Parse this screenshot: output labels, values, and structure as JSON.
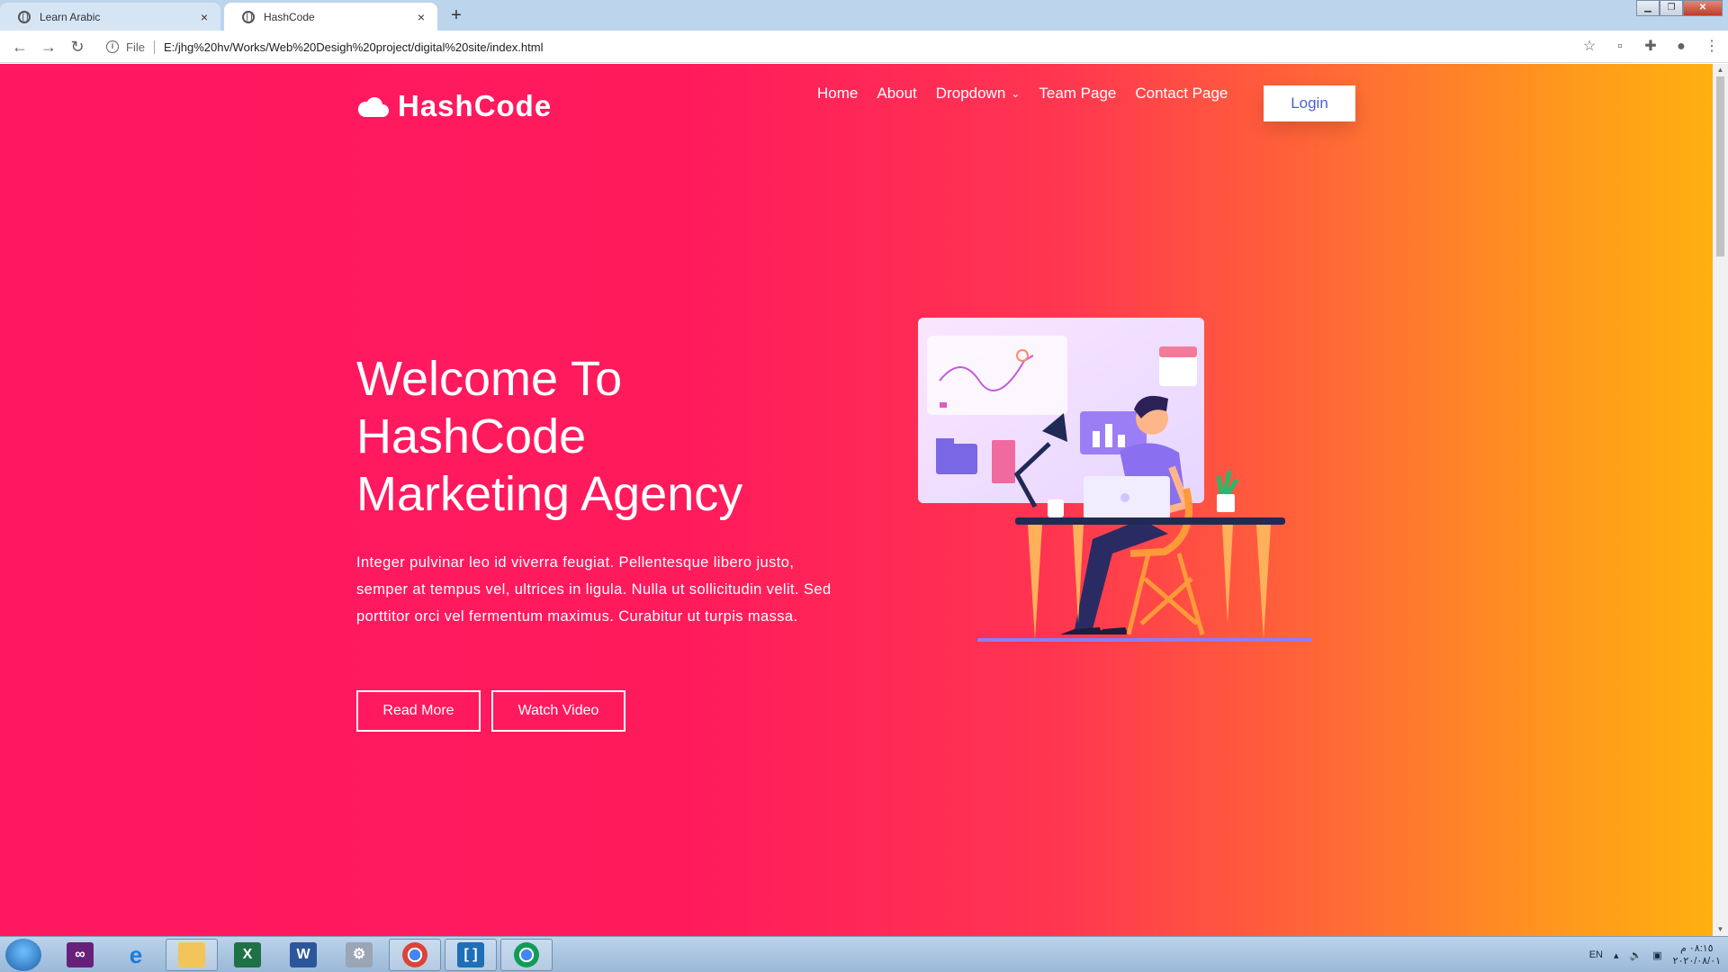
{
  "browser": {
    "tabs": [
      {
        "title": "Learn Arabic",
        "active": false
      },
      {
        "title": "HashCode",
        "active": true
      }
    ],
    "new_tab_symbol": "+",
    "close_symbol": "×",
    "address": {
      "scheme_label": "File",
      "url": "E:/jhg%20hv/Works/Web%20Desigh%20project/digital%20site/index.html"
    },
    "icons": [
      "back-icon",
      "forward-icon",
      "reload-icon",
      "info-icon",
      "star-icon",
      "extension-icon",
      "puzzle-icon",
      "profile-icon",
      "menu-icon"
    ]
  },
  "site": {
    "brand": "HashCode",
    "nav": {
      "home": "Home",
      "about": "About",
      "dropdown": "Dropdown",
      "team": "Team Page",
      "contact": "Contact Page",
      "login": "Login"
    },
    "hero": {
      "title_line1": "Welcome To",
      "title_line2": "HashCode",
      "title_line3": "Marketing Agency",
      "text": "Integer pulvinar leo id viverra feugiat. Pellentesque libero justo, semper at tempus vel, ultrices in ligula. Nulla ut sollicitudin velit. Sed porttitor orci vel fermentum maximus. Curabitur ut turpis massa.",
      "read_more": "Read More",
      "watch_video": "Watch Video"
    },
    "colors": {
      "gradient_start": "#ff1760",
      "gradient_end": "#ffb010",
      "login_text": "#4b5fd6"
    }
  },
  "taskbar": {
    "apps": [
      "windows-start",
      "visual-studio",
      "internet-explorer",
      "file-explorer",
      "excel",
      "word",
      "setup-tool",
      "chrome",
      "brackets",
      "chrome"
    ],
    "tray": {
      "language": "EN",
      "time": "٠٨:١٥ م",
      "date": "٢٠٢٠/٠٨/٠١"
    }
  }
}
